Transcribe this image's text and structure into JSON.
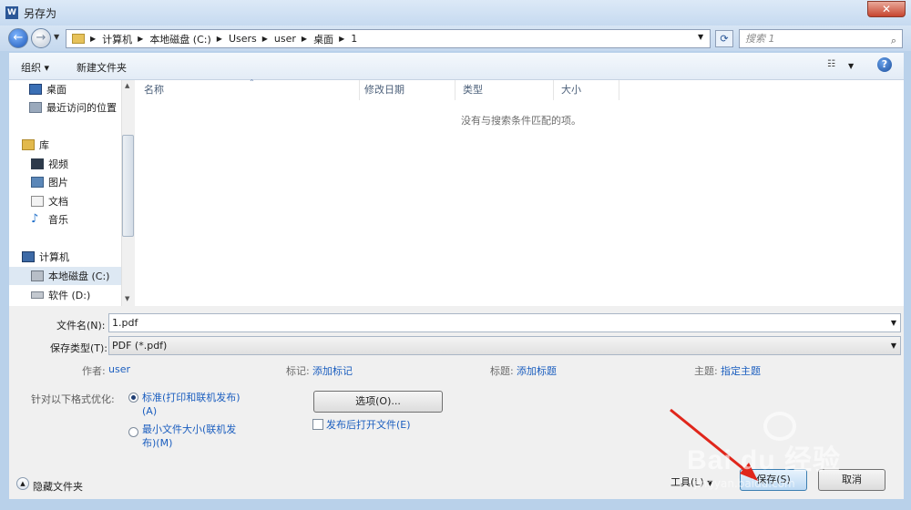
{
  "window": {
    "title": "另存为",
    "app_icon": "W"
  },
  "address": {
    "breadcrumbs": [
      "计算机",
      "本地磁盘 (C:)",
      "Users",
      "user",
      "桌面",
      "1"
    ],
    "search_placeholder": "搜索 1"
  },
  "toolbar": {
    "organize": "组织 ▾",
    "new_folder": "新建文件夹"
  },
  "nav_pane": {
    "items": [
      {
        "label": "桌面",
        "icon": "desktop-icon"
      },
      {
        "label": "最近访问的位置",
        "icon": "recent-places-icon"
      },
      {
        "label": "库",
        "icon": "library-icon"
      },
      {
        "label": "视频",
        "icon": "video-icon"
      },
      {
        "label": "图片",
        "icon": "pictures-icon"
      },
      {
        "label": "文档",
        "icon": "documents-icon"
      },
      {
        "label": "音乐",
        "icon": "music-icon"
      },
      {
        "label": "计算机",
        "icon": "computer-icon"
      },
      {
        "label": "本地磁盘 (C:)",
        "icon": "drive-icon"
      },
      {
        "label": "软件 (D:)",
        "icon": "drive-icon"
      }
    ]
  },
  "file_list": {
    "columns": [
      "名称",
      "修改日期",
      "类型",
      "大小"
    ],
    "empty_message": "没有与搜索条件匹配的项。"
  },
  "form": {
    "filename_label": "文件名(N):",
    "filename_value": "1.pdf",
    "filetype_label": "保存类型(T):",
    "filetype_value": "PDF (*.pdf)",
    "author_label": "作者:",
    "author_value": "user",
    "tags_label": "标记:",
    "tags_value": "添加标记",
    "title_label": "标题:",
    "title_value": "添加标题",
    "subject_label": "主题:",
    "subject_value": "指定主题",
    "optimize_label": "针对以下格式优化:",
    "optimize_standard": "标准(打印和联机发布)",
    "optimize_standard_key": "(A)",
    "optimize_min_a": "最小文件大小(联机发",
    "optimize_min_b": "布)(M)",
    "options_button": "选项(O)...",
    "open_after_publish": "发布后打开文件(E)"
  },
  "footer": {
    "hide_folders": "隐藏文件夹",
    "tools": "工具(L)",
    "save": "保存(S)",
    "cancel": "取消"
  },
  "watermark": {
    "text": "Bai du 经验",
    "url": "jingyan.baidu.com"
  },
  "colors": {
    "link": "#1b5ebf",
    "annotation_arrow": "#e0261b"
  }
}
